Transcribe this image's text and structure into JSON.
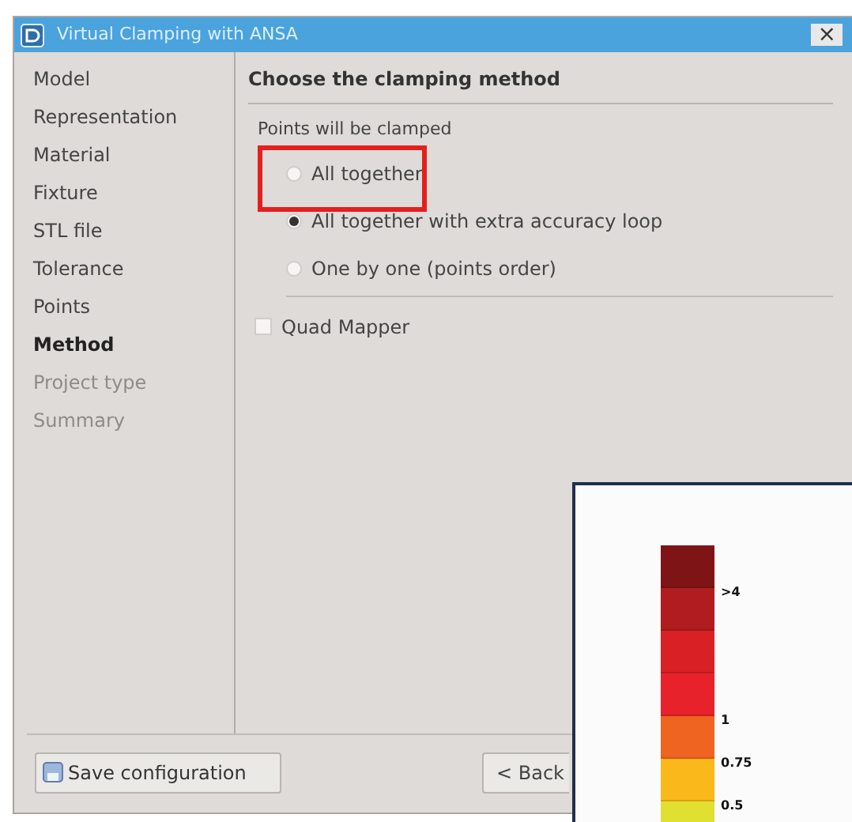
{
  "window": {
    "title": "Virtual Clamping with ANSA",
    "close": "×"
  },
  "sidebar": {
    "items": [
      {
        "label": "Model",
        "selected": false,
        "disabled": false
      },
      {
        "label": "Representation",
        "selected": false,
        "disabled": false
      },
      {
        "label": "Material",
        "selected": false,
        "disabled": false
      },
      {
        "label": "Fixture",
        "selected": false,
        "disabled": false
      },
      {
        "label": "STL file",
        "selected": false,
        "disabled": false
      },
      {
        "label": "Tolerance",
        "selected": false,
        "disabled": false
      },
      {
        "label": "Points",
        "selected": false,
        "disabled": false
      },
      {
        "label": "Method",
        "selected": true,
        "disabled": false
      },
      {
        "label": "Project type",
        "selected": false,
        "disabled": true
      },
      {
        "label": "Summary",
        "selected": false,
        "disabled": true
      }
    ]
  },
  "page": {
    "heading": "Choose the clamping method",
    "group_label": "Points will be clamped",
    "options": [
      {
        "label": "All together",
        "selected": false
      },
      {
        "label": "All together with extra accuracy loop",
        "selected": true
      },
      {
        "label": "One by one (points order)",
        "selected": false
      }
    ],
    "quad_mapper": {
      "label": "Quad Mapper",
      "checked": false
    },
    "highlight": true
  },
  "footer": {
    "save_button": "Save configuration",
    "back_button": "< Back"
  },
  "legend": {
    "swatches": [
      {
        "color": "#7f1416",
        "label": ">4"
      },
      {
        "color": "#b01c1f"
      },
      {
        "color": "#d92025"
      },
      {
        "color": "#e8222a",
        "label": "1"
      },
      {
        "color": "#ee6420",
        "label": "0.75"
      },
      {
        "color": "#fbb81b",
        "label": "0.5"
      },
      {
        "color": "#dfe030"
      }
    ]
  }
}
